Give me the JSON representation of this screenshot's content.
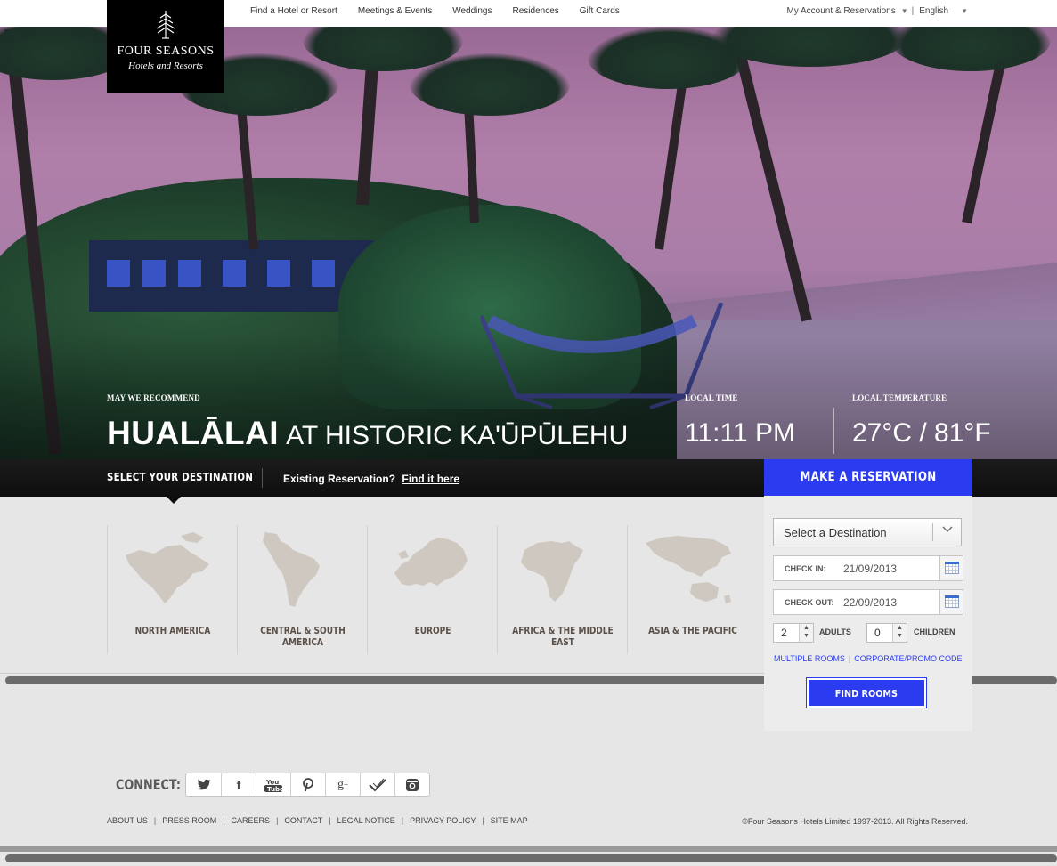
{
  "nav": {
    "links": [
      "Find a Hotel or Resort",
      "Meetings & Events",
      "Weddings",
      "Residences",
      "Gift Cards"
    ],
    "account": "My Account & Reservations",
    "language": "English"
  },
  "logo": {
    "line1": "Four Seasons",
    "line2": "Hotels and Resorts"
  },
  "hero": {
    "recommend_label": "MAY WE RECOMMEND",
    "hotel_bold": "HUALĀLAI",
    "hotel_rest": "AT HISTORIC KA'ŪPŪLEHU",
    "time_label": "LOCAL TIME",
    "time_value": "11:11 PM",
    "temp_label": "LOCAL TEMPERATURE",
    "temp_value": "27°C / 81°F"
  },
  "destbar": {
    "select_label": "SELECT YOUR DESTINATION",
    "existing_text": "Existing Reservation?",
    "existing_link": "Find it here"
  },
  "regions": [
    {
      "label": "NORTH AMERICA"
    },
    {
      "label": "CENTRAL & SOUTH AMERICA"
    },
    {
      "label": "EUROPE"
    },
    {
      "label": "AFRICA & THE MIDDLE EAST"
    },
    {
      "label": "ASIA & THE PACIFIC"
    }
  ],
  "reservation": {
    "title": "MAKE A RESERVATION",
    "destination_placeholder": "Select a Destination",
    "checkin_label": "CHECK IN:",
    "checkin_value": "21/09/2013",
    "checkout_label": "CHECK OUT:",
    "checkout_value": "22/09/2013",
    "adults_value": "2",
    "adults_label": "ADULTS",
    "children_value": "0",
    "children_label": "CHILDREN",
    "multiple_rooms": "MULTIPLE ROOMS",
    "promo_code": "CORPORATE/PROMO CODE",
    "find_button": "FIND ROOMS",
    "accent_color": "#2a3bf0"
  },
  "footer": {
    "connect_label": "CONNECT:",
    "social_icons": [
      "twitter-icon",
      "facebook-icon",
      "youtube-icon",
      "pinterest-icon",
      "google-plus-icon",
      "foursquare-icon",
      "instagram-icon"
    ],
    "links": [
      "ABOUT US",
      "PRESS ROOM",
      "CAREERS",
      "CONTACT",
      "LEGAL NOTICE",
      "PRIVACY POLICY",
      "SITE MAP"
    ],
    "copyright": "©Four Seasons Hotels Limited 1997-2013. All Rights Reserved."
  }
}
